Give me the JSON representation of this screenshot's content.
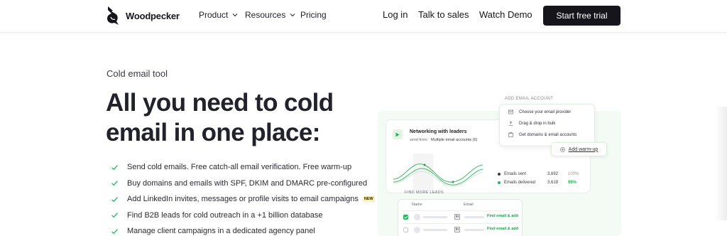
{
  "nav": {
    "brand": "Woodpecker",
    "links": [
      "Product",
      "Resources",
      "Pricing"
    ],
    "login": "Log in",
    "talk": "Talk to sales",
    "demo": "Watch Demo",
    "cta": "Start free trial"
  },
  "hero": {
    "eyebrow": "Cold email tool",
    "headline_line1": "All you need to cold",
    "headline_line2": "email in one place:",
    "features": [
      "Send cold emails. Free catch-all email verification. Free warm-up",
      "Buy domains and emails with SPF, DKIM and DMARC pre-configured",
      "Add LinkedIn invites, messages or profile visits to email campaigns",
      "Find B2B leads for cold outreach in a +1 billion database",
      "Manage client campaigns in a dedicated agency panel"
    ],
    "new_badge": "NEW"
  },
  "illustration": {
    "add_account_label": "ADD EMAIL ACCOUNT",
    "menu": [
      "Choose your email provider",
      "Drag & drop in bulk",
      "Get domains & email accounts"
    ],
    "warm_up": "Add warm-up",
    "campaign_title": "Networking with leaders",
    "send_from_label": "send from:",
    "send_from_value": "Multiple email accounts (6)",
    "stats": [
      {
        "label": "Emails sent",
        "value": "3,692",
        "pct": "100%"
      },
      {
        "label": "Emails delivered",
        "value": "3,618",
        "pct": "98%"
      }
    ],
    "leads_label": "FIND MORE LEADS",
    "leads_cols": [
      "Name",
      "Email"
    ],
    "find_action": "Find email & add",
    "linkedin_mark": "in"
  },
  "colors": {
    "accent_green": "#1fb95a",
    "dark": "#15151b",
    "badge_yellow": "#fff1a8"
  }
}
